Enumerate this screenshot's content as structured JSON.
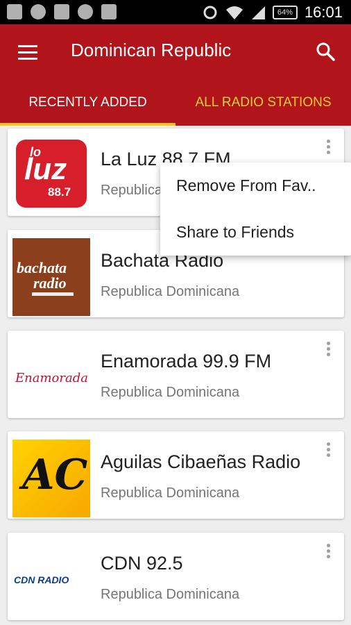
{
  "status_bar": {
    "time": "16:01",
    "battery": "64%",
    "left_icons": [
      "keyboard-icon",
      "chrome-icon",
      "brush-icon",
      "wifi-direct-icon",
      "image-icon"
    ],
    "right_icons": [
      "data-saver-icon",
      "wifi-icon",
      "signal-icon",
      "battery-icon"
    ]
  },
  "app_bar": {
    "title": "Dominican Republic",
    "menu_icon": "hamburger-icon",
    "search_icon": "search-icon",
    "color": "#b1151b"
  },
  "tabs": [
    {
      "label": "RECENTLY ADDED",
      "active": true
    },
    {
      "label": "ALL RADIO STATIONS",
      "active": false
    }
  ],
  "stations": [
    {
      "name": "La Luz 88.7 FM",
      "country": "Republica Dominicana",
      "logo": "la-luz-logo",
      "logo_text": "luz",
      "logo_small": "lo",
      "logo_freq": "88.7"
    },
    {
      "name": "Bachata Radio",
      "country": "Republica Dominicana",
      "logo": "bachata-radio-logo",
      "logo_text": "bachata",
      "logo_text2": "radio"
    },
    {
      "name": "Enamorada 99.9 FM",
      "country": "Republica Dominicana",
      "logo": "enamorada-logo",
      "logo_text": "Enamorada"
    },
    {
      "name": "Aguilas Cibaeñas Radio",
      "country": "Republica Dominicana",
      "logo": "aguilas-logo",
      "logo_text": "AC"
    },
    {
      "name": "CDN 92.5",
      "country": "Republica Dominicana",
      "logo": "cdn-radio-logo",
      "logo_text": "CDN RADIO"
    }
  ],
  "context_menu": {
    "items": [
      "Remove From Fav..",
      "Share to Friends"
    ]
  }
}
